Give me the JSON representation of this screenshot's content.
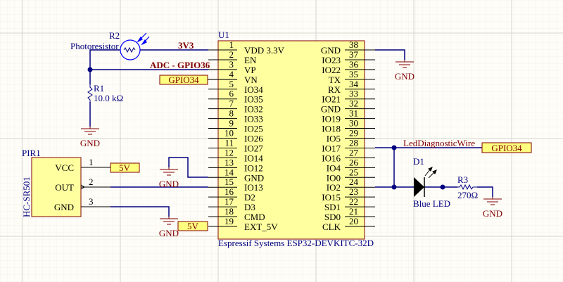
{
  "colors": {
    "wire": "#000080",
    "component_fill": "#ffffa0",
    "net_label": "#800000",
    "background": "#fffdf7"
  },
  "u1": {
    "designator": "U1",
    "description": "Espressif Systems ESP32-DEVKITC-32D",
    "left_pins": [
      {
        "num": "1",
        "name": "VDD 3.3V"
      },
      {
        "num": "2",
        "name": "EN"
      },
      {
        "num": "3",
        "name": "VP"
      },
      {
        "num": "4",
        "name": "VN"
      },
      {
        "num": "5",
        "name": "IO34"
      },
      {
        "num": "6",
        "name": "IO35"
      },
      {
        "num": "7",
        "name": "IO32"
      },
      {
        "num": "8",
        "name": "IO33"
      },
      {
        "num": "9",
        "name": "IO25"
      },
      {
        "num": "10",
        "name": "IO26"
      },
      {
        "num": "11",
        "name": "IO27"
      },
      {
        "num": "12",
        "name": "IO14"
      },
      {
        "num": "13",
        "name": "IO12"
      },
      {
        "num": "14",
        "name": "GND"
      },
      {
        "num": "15",
        "name": "IO13"
      },
      {
        "num": "16",
        "name": "D2"
      },
      {
        "num": "17",
        "name": "D3"
      },
      {
        "num": "18",
        "name": "CMD"
      },
      {
        "num": "19",
        "name": "EXT_5V"
      }
    ],
    "right_pins": [
      {
        "num": "38",
        "name": "GND"
      },
      {
        "num": "37",
        "name": "IO23"
      },
      {
        "num": "36",
        "name": "IO22"
      },
      {
        "num": "35",
        "name": "TX"
      },
      {
        "num": "34",
        "name": "RX"
      },
      {
        "num": "33",
        "name": "IO21"
      },
      {
        "num": "32",
        "name": "GND"
      },
      {
        "num": "31",
        "name": "IO19"
      },
      {
        "num": "30",
        "name": "IO18"
      },
      {
        "num": "29",
        "name": "IO5"
      },
      {
        "num": "28",
        "name": "IO17"
      },
      {
        "num": "27",
        "name": "IO16"
      },
      {
        "num": "26",
        "name": "IO4"
      },
      {
        "num": "25",
        "name": "IO0"
      },
      {
        "num": "24",
        "name": "IO2"
      },
      {
        "num": "23",
        "name": "IO15"
      },
      {
        "num": "22",
        "name": "SD1"
      },
      {
        "num": "21",
        "name": "SD0"
      },
      {
        "num": "20",
        "name": "CLK"
      }
    ]
  },
  "r2": {
    "designator": "R2",
    "comment": "Photoresistor"
  },
  "r1": {
    "designator": "R1",
    "value": "10.0 kΩ"
  },
  "r3": {
    "designator": "R3",
    "value": "270Ω"
  },
  "d1": {
    "designator": "D1",
    "comment": "Blue LED"
  },
  "pir1": {
    "designator": "PIR1",
    "comment": "HC-SR501",
    "pins": [
      {
        "num": "1",
        "name": "VCC"
      },
      {
        "num": "2",
        "name": "OUT"
      },
      {
        "num": "3",
        "name": "GND"
      }
    ]
  },
  "nets": {
    "v3": "3V3",
    "adc": "ADC - GPIO36",
    "led_wire": "LedDiagnosticWire"
  },
  "ports": {
    "gpio34_left": "GPIO34",
    "gpio34_right": "GPIO34",
    "v5_pir": "5V",
    "v5_u1": "5V"
  },
  "gnd_label": "GND"
}
